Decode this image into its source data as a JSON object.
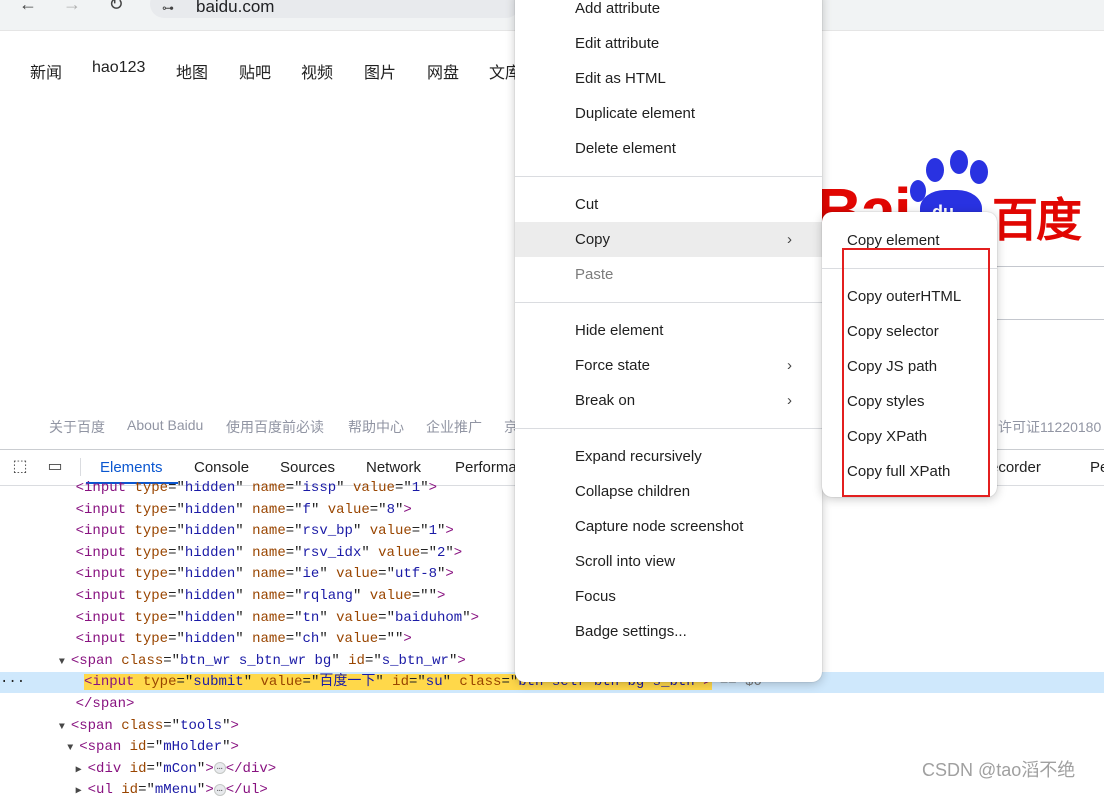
{
  "browser": {
    "url": "baidu.com",
    "back_icon": "arrow-left-icon",
    "forward_icon": "arrow-right-icon",
    "reload_icon": "reload-icon",
    "site_info_icon": "tune-icon"
  },
  "baidu": {
    "nav": [
      "新闻",
      "hao123",
      "地图",
      "贴吧",
      "视频",
      "图片",
      "网盘",
      "文库"
    ],
    "logo": {
      "latin": "Bai",
      "paw_text": "du",
      "chinese": "百度",
      "color": "#e10602",
      "paw_color": "#2932e1"
    },
    "footer": [
      "关于百度",
      "About Baidu",
      "使用百度前必读",
      "帮助中心",
      "企业推广",
      "京",
      "许可证11220180"
    ]
  },
  "devtools": {
    "tabs": [
      "Elements",
      "Console",
      "Sources",
      "Network",
      "Performa",
      "ecorder",
      "Pe"
    ],
    "active_tab": "Elements",
    "dom_lines": [
      {
        "pre": "        ",
        "tag": "input",
        "attrs": [
          [
            "type",
            "hidden"
          ],
          [
            "name",
            "issp"
          ],
          [
            "value",
            "1"
          ]
        ]
      },
      {
        "pre": "        ",
        "tag": "input",
        "attrs": [
          [
            "type",
            "hidden"
          ],
          [
            "name",
            "f"
          ],
          [
            "value",
            "8"
          ]
        ]
      },
      {
        "pre": "        ",
        "tag": "input",
        "attrs": [
          [
            "type",
            "hidden"
          ],
          [
            "name",
            "rsv_bp"
          ],
          [
            "value",
            "1"
          ]
        ]
      },
      {
        "pre": "        ",
        "tag": "input",
        "attrs": [
          [
            "type",
            "hidden"
          ],
          [
            "name",
            "rsv_idx"
          ],
          [
            "value",
            "2"
          ]
        ]
      },
      {
        "pre": "        ",
        "tag": "input",
        "attrs": [
          [
            "type",
            "hidden"
          ],
          [
            "name",
            "ie"
          ],
          [
            "value",
            "utf-8"
          ]
        ]
      },
      {
        "pre": "        ",
        "tag": "input",
        "attrs": [
          [
            "type",
            "hidden"
          ],
          [
            "name",
            "rqlang"
          ],
          [
            "value",
            ""
          ]
        ]
      },
      {
        "pre": "        ",
        "tag": "input",
        "attrs": [
          [
            "type",
            "hidden"
          ],
          [
            "name",
            "tn"
          ],
          [
            "value",
            "baiduhom"
          ]
        ]
      },
      {
        "pre": "        ",
        "tag": "input",
        "attrs": [
          [
            "type",
            "hidden"
          ],
          [
            "name",
            "ch"
          ],
          [
            "value",
            ""
          ]
        ]
      },
      {
        "pre": "       ",
        "tri": "▼",
        "tag": "span",
        "attrs": [
          [
            "class",
            "btn_wr s_btn_wr bg"
          ],
          [
            "id",
            "s_btn_wr"
          ]
        ]
      },
      {
        "pre": "         ",
        "tag": "input",
        "selected": true,
        "attrs": [
          [
            "type",
            "submit"
          ],
          [
            "value",
            "百度一下"
          ],
          [
            "id",
            "su"
          ],
          [
            "class",
            "btn self-btn bg s_btn"
          ]
        ],
        "suffix": " == $0"
      },
      {
        "pre": "        ",
        "close": "span"
      },
      {
        "pre": "       ",
        "tri": "▼",
        "tag": "span",
        "attrs": [
          [
            "class",
            "tools"
          ]
        ]
      },
      {
        "pre": "        ",
        "tri": "▼",
        "tag": "span",
        "attrs": [
          [
            "id",
            "mHolder"
          ]
        ]
      },
      {
        "pre": "         ",
        "tri": "▶",
        "tag": "div",
        "attrs": [
          [
            "id",
            "mCon"
          ]
        ],
        "collapsed": true
      },
      {
        "pre": "         ",
        "tri": "▶",
        "tag": "ul",
        "attrs": [
          [
            "id",
            "mMenu"
          ]
        ],
        "collapsed": true
      }
    ],
    "gutter_dots": "···"
  },
  "context_menu": {
    "items": [
      {
        "label": "Add attribute"
      },
      {
        "label": "Edit attribute"
      },
      {
        "label": "Edit as HTML"
      },
      {
        "label": "Duplicate element"
      },
      {
        "label": "Delete element"
      },
      {
        "separator": true
      },
      {
        "label": "Cut"
      },
      {
        "label": "Copy",
        "submenu": true,
        "hover": true
      },
      {
        "label": "Paste",
        "disabled": true
      },
      {
        "separator": true
      },
      {
        "label": "Hide element"
      },
      {
        "label": "Force state",
        "submenu": true
      },
      {
        "label": "Break on",
        "submenu": true
      },
      {
        "separator": true
      },
      {
        "label": "Expand recursively"
      },
      {
        "label": "Collapse children"
      },
      {
        "label": "Capture node screenshot"
      },
      {
        "label": "Scroll into view"
      },
      {
        "label": "Focus"
      },
      {
        "label": "Badge settings..."
      }
    ],
    "chevron_icon": "chevron-right-icon"
  },
  "copy_submenu": {
    "items": [
      {
        "label": "Copy element"
      },
      {
        "separator": true
      },
      {
        "label": "Copy outerHTML"
      },
      {
        "label": "Copy selector"
      },
      {
        "label": "Copy JS path"
      },
      {
        "label": "Copy styles"
      },
      {
        "label": "Copy XPath"
      },
      {
        "label": "Copy full XPath"
      }
    ],
    "highlight_color": "#e31f1f"
  },
  "watermark": "CSDN @tao滔不绝"
}
